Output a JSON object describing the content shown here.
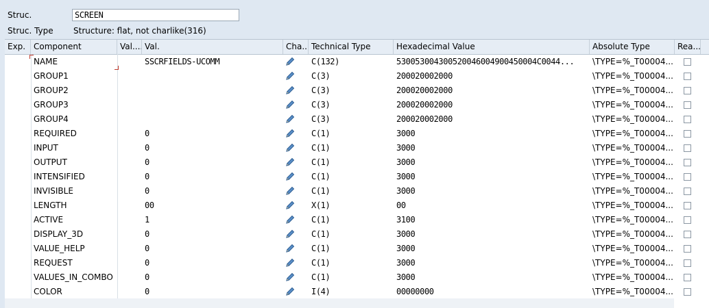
{
  "header": {
    "struct_label": "Struc.",
    "struct_value": "SCREEN",
    "type_label": "Struc. Type",
    "type_value": "Structure: flat, not charlike(316)"
  },
  "columns": {
    "exp": "Exp.",
    "component": "Component",
    "val_short": "Val....",
    "val": "Val.",
    "cha": "Cha...",
    "tech_type": "Technical Type",
    "hex": "Hexadecimal Value",
    "abs_type": "Absolute Type",
    "rea": "Rea..."
  },
  "icons": {
    "change": "pencil-icon",
    "readonly": "checkbox"
  },
  "rows": [
    {
      "component": "NAME",
      "val": "SSCRFIELDS-UCOMM",
      "tech": "C(132)",
      "hex": "530053004300520046004900450004C0044...",
      "abs": "\\TYPE=%_T00004..."
    },
    {
      "component": "GROUP1",
      "val": "",
      "tech": "C(3)",
      "hex": "200020002000",
      "abs": "\\TYPE=%_T00004..."
    },
    {
      "component": "GROUP2",
      "val": "",
      "tech": "C(3)",
      "hex": "200020002000",
      "abs": "\\TYPE=%_T00004..."
    },
    {
      "component": "GROUP3",
      "val": "",
      "tech": "C(3)",
      "hex": "200020002000",
      "abs": "\\TYPE=%_T00004..."
    },
    {
      "component": "GROUP4",
      "val": "",
      "tech": "C(3)",
      "hex": "200020002000",
      "abs": "\\TYPE=%_T00004..."
    },
    {
      "component": "REQUIRED",
      "val": "0",
      "tech": "C(1)",
      "hex": "3000",
      "abs": "\\TYPE=%_T00004..."
    },
    {
      "component": "INPUT",
      "val": "0",
      "tech": "C(1)",
      "hex": "3000",
      "abs": "\\TYPE=%_T00004..."
    },
    {
      "component": "OUTPUT",
      "val": "0",
      "tech": "C(1)",
      "hex": "3000",
      "abs": "\\TYPE=%_T00004..."
    },
    {
      "component": "INTENSIFIED",
      "val": "0",
      "tech": "C(1)",
      "hex": "3000",
      "abs": "\\TYPE=%_T00004..."
    },
    {
      "component": "INVISIBLE",
      "val": "0",
      "tech": "C(1)",
      "hex": "3000",
      "abs": "\\TYPE=%_T00004..."
    },
    {
      "component": "LENGTH",
      "val": "00",
      "tech": "X(1)",
      "hex": "00",
      "abs": "\\TYPE=%_T00004..."
    },
    {
      "component": "ACTIVE",
      "val": "1",
      "tech": "C(1)",
      "hex": "3100",
      "abs": "\\TYPE=%_T00004..."
    },
    {
      "component": "DISPLAY_3D",
      "val": "0",
      "tech": "C(1)",
      "hex": "3000",
      "abs": "\\TYPE=%_T00004..."
    },
    {
      "component": "VALUE_HELP",
      "val": "0",
      "tech": "C(1)",
      "hex": "3000",
      "abs": "\\TYPE=%_T00004..."
    },
    {
      "component": "REQUEST",
      "val": "0",
      "tech": "C(1)",
      "hex": "3000",
      "abs": "\\TYPE=%_T00004..."
    },
    {
      "component": "VALUES_IN_COMBO",
      "val": "0",
      "tech": "C(1)",
      "hex": "3000",
      "abs": "\\TYPE=%_T00004..."
    },
    {
      "component": "COLOR",
      "val": "0",
      "tech": "I(4)",
      "hex": "00000000",
      "abs": "\\TYPE=%_T00004..."
    }
  ]
}
